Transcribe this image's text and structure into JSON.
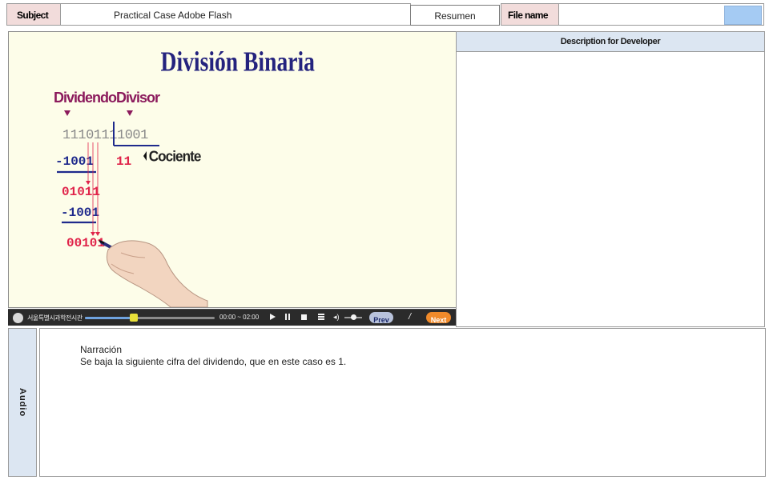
{
  "header": {
    "subject_label": "Subject",
    "subject_value": "Practical Case Adobe Flash",
    "resumen_label": "Resumen",
    "file_name_label": "File name",
    "file_name_value": ""
  },
  "dev_panel": {
    "title": "Description for Developer",
    "content": ""
  },
  "slide": {
    "title": "División Binaria",
    "dividend_label": "Dividendo",
    "divisor_label": "Divisor",
    "dividend_value": "1110111",
    "divisor_value": "1001",
    "quotient_value": "11",
    "quotient_label": "Cociente",
    "step1_sub": "-1001",
    "step1_remainder_main": "0101",
    "step1_remainder_digit": "1",
    "step2_sub": "-1001",
    "step2_remainder_main": "0010",
    "step2_remainder_digit": "1",
    "colors": {
      "background": "#fdfde9",
      "title": "#24237e",
      "labels": "#8b1a5c",
      "red": "#e0244a",
      "navy": "#1f2a8c",
      "gray": "#8a8a8a"
    }
  },
  "player": {
    "brand": "서울특별시과학전시관",
    "time": "00:00 ~ 02:00",
    "play_icon": "play-icon",
    "pause_icon": "pause-icon",
    "stop_icon": "stop-icon",
    "menu_icon": "menu-icon",
    "volume_icon": "volume-icon",
    "prev_label": "Prev",
    "separator": "/",
    "next_label": "Next",
    "progress_fraction": 0.38
  },
  "audio": {
    "label": "Audio",
    "narration_title": "Narración",
    "narration_text": "Se baja la siguiente cifra del dividendo, que en este caso es 1."
  }
}
